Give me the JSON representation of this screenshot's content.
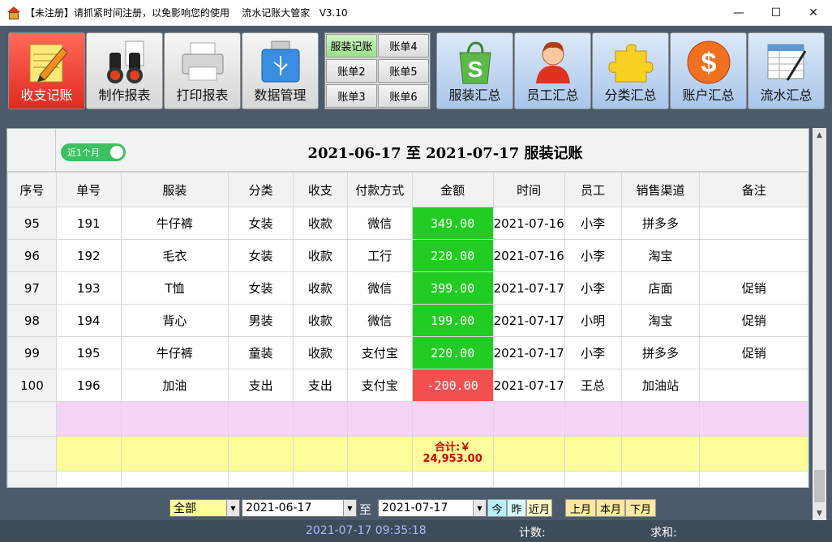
{
  "window": {
    "title": "【未注册】请抓紧时间注册，以免影响您的使用    流水记账大管家   V3.10",
    "minimize": "—",
    "maximize": "☐",
    "close": "✕"
  },
  "toolbar": {
    "buttons": [
      {
        "label": "收支记账",
        "icon": "notepad-pencil-icon",
        "active": true
      },
      {
        "label": "制作报表",
        "icon": "binoculars-icon"
      },
      {
        "label": "打印报表",
        "icon": "printer-icon"
      },
      {
        "label": "数据管理",
        "icon": "usb-drive-icon"
      }
    ],
    "ledgers": [
      "服装记账",
      "账单4",
      "账单2",
      "账单5",
      "账单3",
      "账单6"
    ],
    "summaries": [
      {
        "label": "服装汇总",
        "icon": "shopping-bag-icon"
      },
      {
        "label": "员工汇总",
        "icon": "person-icon"
      },
      {
        "label": "分类汇总",
        "icon": "puzzle-icon"
      },
      {
        "label": "账户汇总",
        "icon": "dollar-coin-icon"
      },
      {
        "label": "流水汇总",
        "icon": "spreadsheet-pen-icon"
      }
    ]
  },
  "panel": {
    "toggle_label": "近1个月",
    "caption": "2021-06-17  至  2021-07-17  服装记账",
    "columns": [
      "序号",
      "单号",
      "服装",
      "分类",
      "收支",
      "付款方式",
      "金额",
      "时间",
      "员工",
      "销售渠道",
      "备注"
    ],
    "rows": [
      [
        "95",
        "191",
        "牛仔裤",
        "女装",
        "收款",
        "微信",
        "349.00",
        "2021-07-16",
        "小李",
        "拼多多",
        ""
      ],
      [
        "96",
        "192",
        "毛衣",
        "女装",
        "收款",
        "工行",
        "220.00",
        "2021-07-16",
        "小李",
        "淘宝",
        ""
      ],
      [
        "97",
        "193",
        "T恤",
        "女装",
        "收款",
        "微信",
        "399.00",
        "2021-07-17",
        "小李",
        "店面",
        "促销"
      ],
      [
        "98",
        "194",
        "背心",
        "男装",
        "收款",
        "微信",
        "199.00",
        "2021-07-17",
        "小明",
        "淘宝",
        "促销"
      ],
      [
        "99",
        "195",
        "牛仔裤",
        "童装",
        "收款",
        "支付宝",
        "220.00",
        "2021-07-17",
        "小李",
        "拼多多",
        "促销"
      ],
      [
        "100",
        "196",
        "加油",
        "支出",
        "支出",
        "支付宝",
        "-200.00",
        "2021-07-17",
        "王总",
        "加油站",
        ""
      ]
    ],
    "total_label": "合计:￥",
    "total_value": "24,953.00"
  },
  "filter": {
    "scope": "全部",
    "date_from": "2021-06-17",
    "to_label": "至",
    "date_to": "2021-07-17",
    "quick": [
      "今",
      "昨",
      "近月",
      "上月",
      "本月",
      "下月"
    ]
  },
  "status": {
    "clock": "2021-07-17  09:35:18",
    "count_label": "计数:",
    "sum_label": "求和:"
  },
  "colors": {
    "income_cell": "#22cc22",
    "expense_cell": "#f05050",
    "total_text": "#d00000",
    "active_tool": "#e02a20"
  }
}
